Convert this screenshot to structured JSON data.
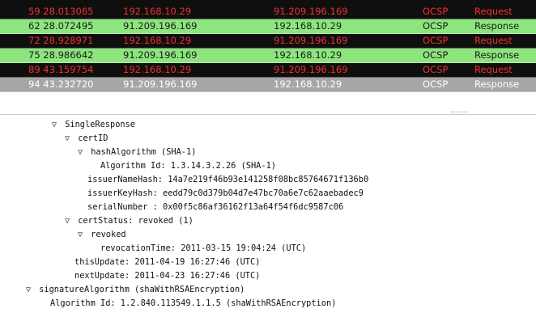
{
  "packets": [
    {
      "no_time": "59 28.013065",
      "src": "192.168.10.29",
      "dst": "91.209.196.169",
      "proto": "OCSP",
      "info": "Request"
    },
    {
      "no_time": "62 28.072495",
      "src": "91.209.196.169",
      "dst": "192.168.10.29",
      "proto": "OCSP",
      "info": "Response"
    },
    {
      "no_time": "72 28.928971",
      "src": "192.168.10.29",
      "dst": "91.209.196.169",
      "proto": "OCSP",
      "info": "Request"
    },
    {
      "no_time": "75 28.986642",
      "src": "91.209.196.169",
      "dst": "192.168.10.29",
      "proto": "OCSP",
      "info": "Response"
    },
    {
      "no_time": "89 43.159754",
      "src": "192.168.10.29",
      "dst": "91.209.196.169",
      "proto": "OCSP",
      "info": "Request"
    },
    {
      "no_time": "94 43.232720",
      "src": "91.209.196.169",
      "dst": "192.168.10.29",
      "proto": "OCSP",
      "info": "Response"
    }
  ],
  "divider_dots": "......",
  "tree": {
    "single_response": "SingleResponse",
    "cert_id": "certID",
    "hash_algorithm": "hashAlgorithm (SHA-1)",
    "algorithm_id": "Algorithm Id: 1.3.14.3.2.26 (SHA-1)",
    "issuer_name_hash": "issuerNameHash: 14a7e219f46b93e141258f08bc85764671f136b0",
    "issuer_key_hash": "issuerKeyHash: eedd79c0d379b04d7e47bc70a6e7c62aaebadec9",
    "serial_number": "serialNumber : 0x00f5c86af36162f13a64f54f6dc9587c06",
    "cert_status": "certStatus: revoked (1)",
    "revoked": "revoked",
    "revocation_time": "revocationTime: 2011-03-15 19:04:24 (UTC)",
    "this_update": "thisUpdate: 2011-04-19 16:27:46 (UTC)",
    "next_update": "nextUpdate: 2011-04-23 16:27:46 (UTC)",
    "signature_algorithm": "signatureAlgorithm (shaWithRSAEncryption)",
    "sig_algorithm_id": "Algorithm Id: 1.2.840.113549.1.1.5 (shaWithRSAEncryption)"
  },
  "icons": {
    "expanded": "triangle-down-icon"
  },
  "colors": {
    "request_bg": "#0f0f0f",
    "request_fg": "#f03030",
    "response_bg": "#8ce57d",
    "selected_bg": "#a6a6a6"
  }
}
